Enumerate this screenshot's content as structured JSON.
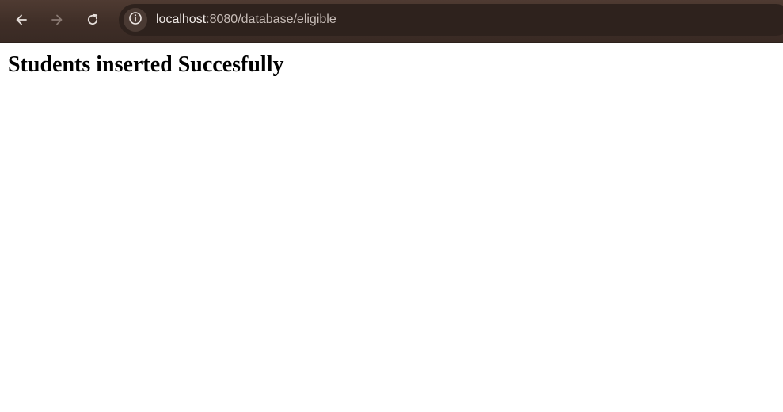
{
  "browser": {
    "colors": {
      "toolbar": "#3f2e27",
      "omnibox": "#2e221d",
      "icon_active": "#e6dfdb",
      "icon_disabled": "#8a7a73"
    },
    "nav": {
      "back_icon": "arrow-left",
      "forward_icon": "arrow-right",
      "forward_enabled": false,
      "reload_icon": "reload"
    },
    "address_bar": {
      "site_info_icon": "info-circle",
      "host": "localhost",
      "rest": ":8080/database/eligible"
    }
  },
  "page": {
    "heading": "Students inserted Succesfully"
  }
}
